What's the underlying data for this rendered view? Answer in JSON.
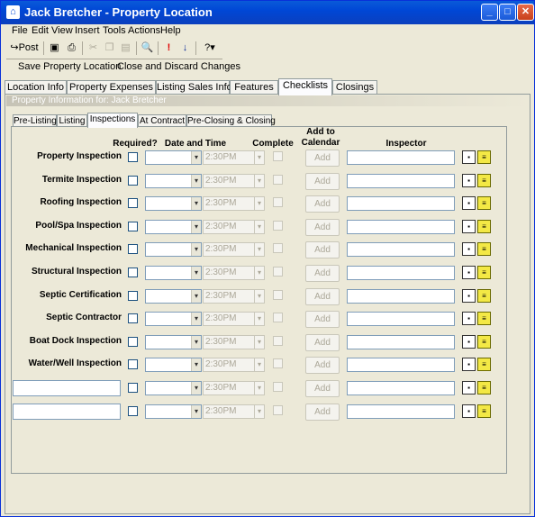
{
  "window": {
    "title": "Jack Bretcher - Property Location",
    "minimize_glyph": "_",
    "maximize_glyph": "□",
    "close_glyph": "✕"
  },
  "menu": [
    "File",
    "Edit",
    "View",
    "Insert",
    "Tools",
    "Actions",
    "Help"
  ],
  "toolbar": {
    "post_label": "Post",
    "icons": [
      "post-icon",
      "save-icon",
      "print-icon",
      "cut-icon",
      "copy-icon",
      "paste-icon",
      "print-preview-icon",
      "high-importance-icon",
      "low-importance-icon",
      "help-icon"
    ]
  },
  "actions": {
    "save": "Save Property Location",
    "close": "Close and Discard Changes"
  },
  "tabs": [
    "Location Info",
    "Property Expenses",
    "Listing Sales Info",
    "Features",
    "Checklists",
    "Closings"
  ],
  "active_tab": "Checklists",
  "info_bar": "Property Information for: Jack Bretcher",
  "subtabs": [
    "Pre-Listing",
    "Listing",
    "Inspections",
    "At Contract",
    "Pre-Closing & Closing"
  ],
  "active_subtab": "Inspections",
  "headers": {
    "required": "Required?",
    "date_time": "Date and Time",
    "complete": "Complete",
    "add_to_calendar": "Add to Calendar",
    "inspector": "Inspector"
  },
  "rows": [
    {
      "label": "Property Inspection",
      "time": "2:30PM",
      "add": "Add"
    },
    {
      "label": "Termite Inspection",
      "time": "2:30PM",
      "add": "Add"
    },
    {
      "label": "Roofing Inspection",
      "time": "2:30PM",
      "add": "Add"
    },
    {
      "label": "Pool/Spa Inspection",
      "time": "2:30PM",
      "add": "Add"
    },
    {
      "label": "Mechanical Inspection",
      "time": "2:30PM",
      "add": "Add"
    },
    {
      "label": "Structural Inspection",
      "time": "2:30PM",
      "add": "Add"
    },
    {
      "label": "Septic Certification",
      "time": "2:30PM",
      "add": "Add"
    },
    {
      "label": "Septic Contractor",
      "time": "2:30PM",
      "add": "Add"
    },
    {
      "label": "Boat Dock Inspection",
      "time": "2:30PM",
      "add": "Add"
    },
    {
      "label": "Water/Well Inspection",
      "time": "2:30PM",
      "add": "Add"
    }
  ],
  "custom_rows": [
    {
      "label_value": "",
      "time": "2:30PM",
      "add": "Add"
    },
    {
      "label_value": "",
      "time": "2:30PM",
      "add": "Add"
    }
  ]
}
